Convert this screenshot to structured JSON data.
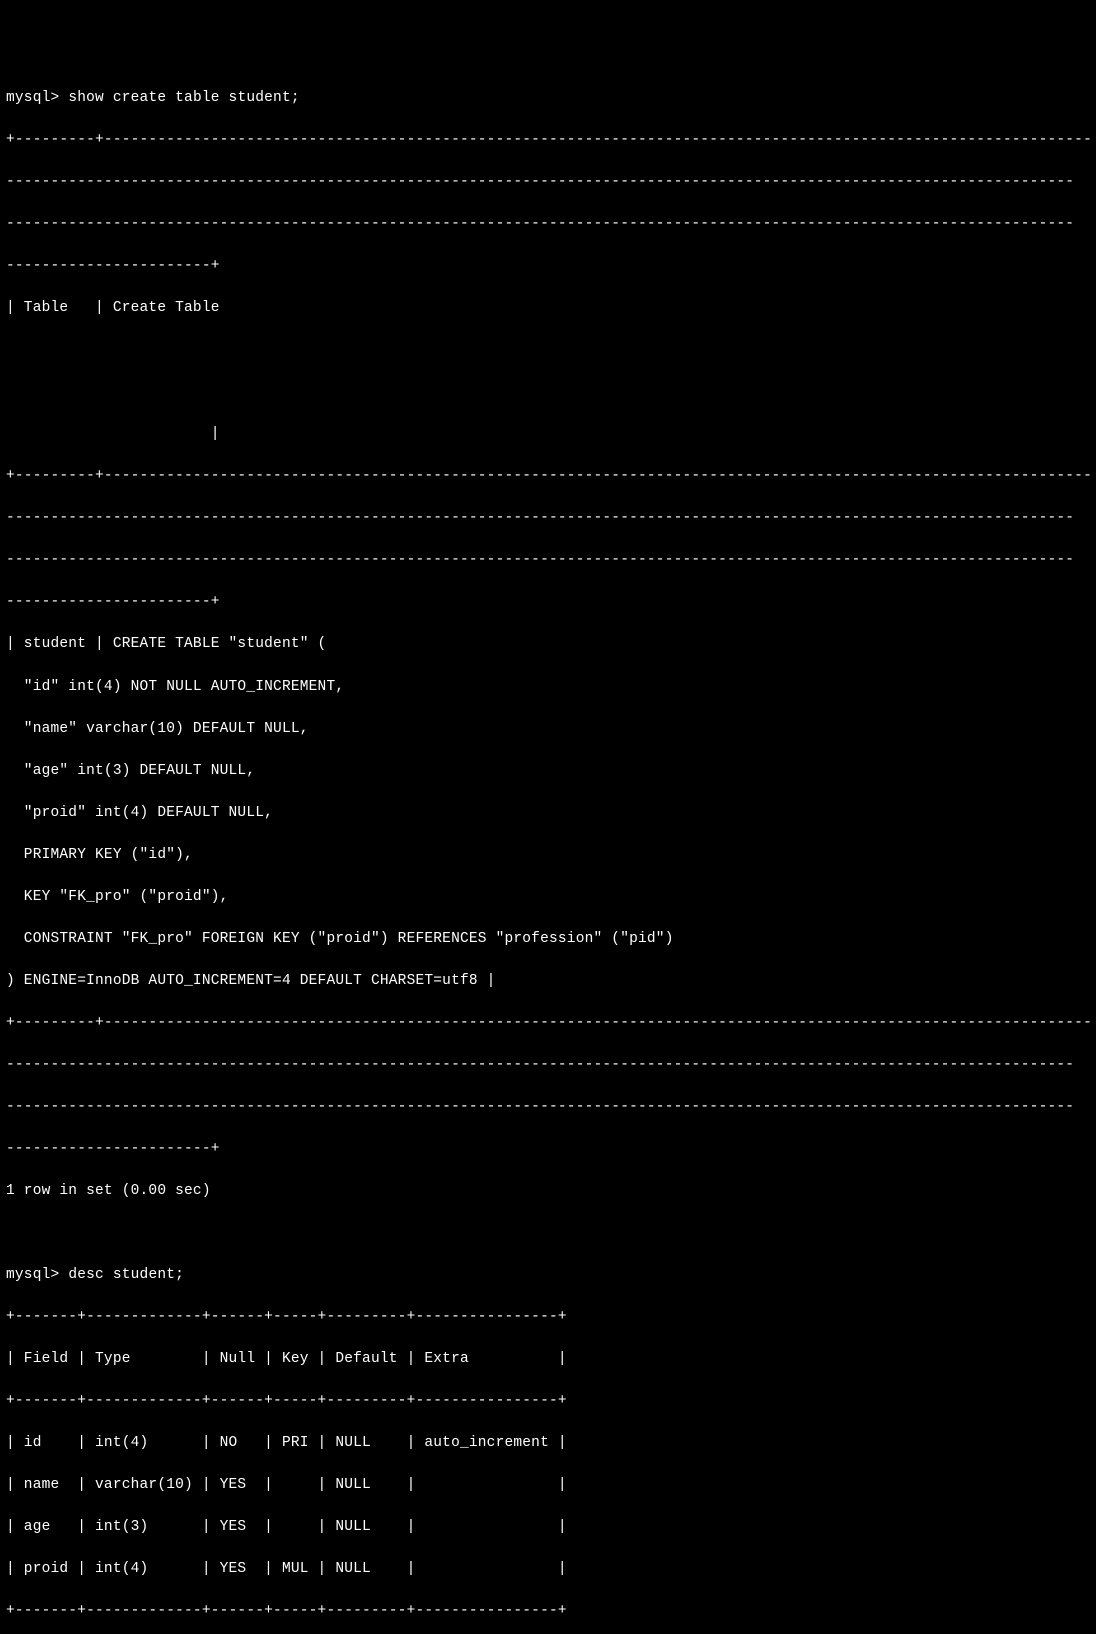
{
  "prompt": "mysql>",
  "commands": {
    "show_create": "show create table student;",
    "desc": "desc student;"
  },
  "show_create_output": {
    "sep1": "+---------+---------------------------------------------------------------------------------------------------------------",
    "sep_cont": "------------------------------------------------------------------------------------------------------------------------",
    "sep_cont2": "------------------------------------------------------------------------------------------------------------------------",
    "sep_end": "-----------------------+",
    "header_row": "| Table   | Create Table                                                                                                          ",
    "header_blank1": "                                                                                                                        ",
    "header_blank2": "                                                                                                                        ",
    "header_pipe": "                       |",
    "data_row_start": "| student | CREATE TABLE \"student\" (",
    "create_lines": [
      "  \"id\" int(4) NOT NULL AUTO_INCREMENT,",
      "  \"name\" varchar(10) DEFAULT NULL,",
      "  \"age\" int(3) DEFAULT NULL,",
      "  \"proid\" int(4) DEFAULT NULL,",
      "  PRIMARY KEY (\"id\"),",
      "  KEY \"FK_pro\" (\"proid\"),",
      "  CONSTRAINT \"FK_pro\" FOREIGN KEY (\"proid\") REFERENCES \"profession\" (\"pid\")",
      ") ENGINE=InnoDB AUTO_INCREMENT=4 DEFAULT CHARSET=utf8 |"
    ],
    "result_text": "1 row in set (0.00 sec)"
  },
  "desc_output": {
    "sep": "+-------+-------------+------+-----+---------+----------------+",
    "header": "| Field | Type        | Null | Key | Default | Extra          |",
    "rows": [
      "| id    | int(4)      | NO   | PRI | NULL    | auto_increment |",
      "| name  | varchar(10) | YES  |     | NULL    |                |",
      "| age   | int(3)      | YES  |     | NULL    |                |",
      "| proid | int(4)      | YES  | MUL | NULL    |                |"
    ]
  }
}
